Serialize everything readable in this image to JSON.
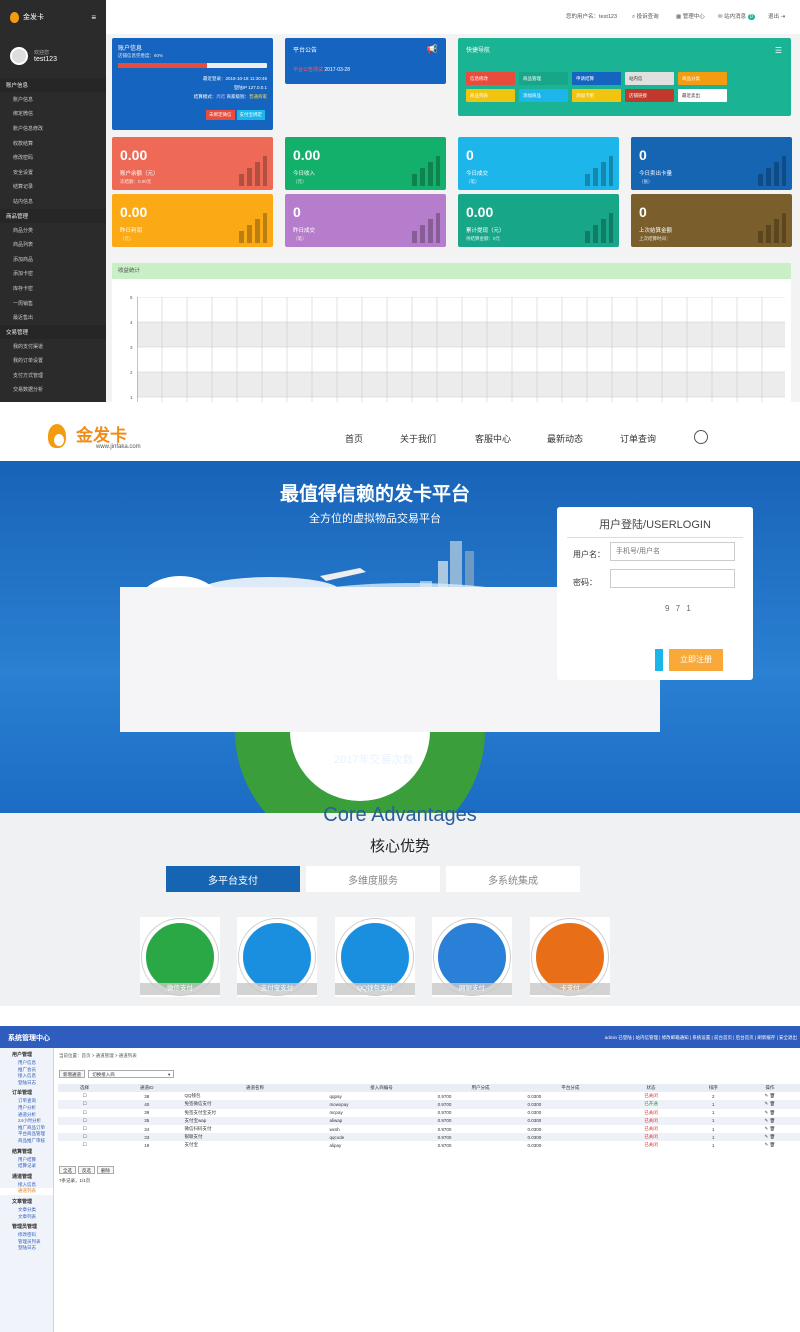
{
  "dashboard": {
    "sidebar": {
      "logo": "金发卡",
      "welcome": "欢迎您",
      "username": "test123",
      "groups": [
        {
          "title": "账户信息",
          "items": [
            "账户信息",
            "绑定微信",
            "账户信息修改",
            "收款结算",
            "修改密码",
            "安全设置",
            "结算记录",
            "站内信息"
          ]
        },
        {
          "title": "商品管理",
          "items": [
            "商品分类",
            "商品列表",
            "添加商品",
            "添加卡密",
            "库存卡密",
            "一周销售",
            "最近售出"
          ]
        },
        {
          "title": "交易管理",
          "items": [
            "我的支付渠道",
            "我的订单设置",
            "支付方式管理",
            "交易数据分析"
          ]
        }
      ]
    },
    "topbar": {
      "user": "您的用户名：test123",
      "complaint": "投诉查询",
      "manage": "管理中心",
      "messages": "站内消息",
      "message_count": "0",
      "logout": "退出"
    },
    "account_panel": {
      "title": "账户信息",
      "subtitle": "店铺信息完善度：60%",
      "progress": 0.6,
      "last_login": "最近登录：2016-10-18 11:30:46",
      "login_ip": "登陆IP 127.0.0.1",
      "settle_mode": "结算模式：",
      "settle_value": "周结",
      "level_label": "商家级别：",
      "level_value": "普通商家",
      "btn_wechat": "未绑定微信",
      "btn_pay": "支付宝绑定"
    },
    "notice_panel": {
      "title": "平台公告",
      "item": "平台公告测试",
      "date": "2017-03-28"
    },
    "quicknav": {
      "title": "快捷导航",
      "buttons": [
        "信息修改",
        "商品管理",
        "申请结算",
        "站内信",
        "商品分类",
        "商品列表",
        "添加商品",
        "添加卡密",
        "店铺链接",
        "最近卖出"
      ]
    },
    "stats": [
      {
        "value": "0.00",
        "label": "账户余额（元）",
        "sub": "冻结额：0.00元",
        "color": "#ee6a57"
      },
      {
        "value": "0.00",
        "label": "今日收入",
        "sub": "（元）",
        "color": "#13b06b"
      },
      {
        "value": "0",
        "label": "今日成交",
        "sub": "（笔）",
        "color": "#1cb6ea"
      },
      {
        "value": "0",
        "label": "今日卖出卡量",
        "sub": "（张）",
        "color": "#1565b3"
      },
      {
        "value": "0.00",
        "label": "昨日利润",
        "sub": "（元）",
        "color": "#fbaa16"
      },
      {
        "value": "0",
        "label": "昨日成交",
        "sub": "（笔）",
        "color": "#b57dcc"
      },
      {
        "value": "0.00",
        "label": "累计提现（元）",
        "sub": "待结算金额：0元",
        "color": "#18a689"
      },
      {
        "value": "0",
        "label": "上次结算金额",
        "sub": "上次结算时间：",
        "color": "#7a5e2b"
      }
    ],
    "chart": {
      "title": "收益统计",
      "y_ticks": [
        "5",
        "4",
        "3",
        "2",
        "1"
      ]
    }
  },
  "landing": {
    "brand": "金发卡",
    "domain": "www.jinfaka.com",
    "nav": [
      "首页",
      "关于我们",
      "客服中心",
      "最新动态",
      "订单查询"
    ],
    "hero_title": "最值得信赖的发卡平台",
    "hero_subtitle": "全方位的虚拟物品交易平台",
    "hero_caption": "2017年交易次数",
    "login": {
      "title": "用户登陆/USERLOGIN",
      "user_label": "用户名：",
      "user_placeholder": "手机号/用户名",
      "pass_label": "密码：",
      "captcha": "9 7 1",
      "register": "立即注册"
    },
    "advantages_en": "Core Advantages",
    "advantages_cn": "核心优势",
    "tabs": [
      "多平台支付",
      "多维度服务",
      "多系统集成"
    ],
    "features": [
      {
        "label": "微信支付",
        "color": "#2aa845"
      },
      {
        "label": "支付宝支付",
        "color": "#1a8fe0"
      },
      {
        "label": "QQ钱包支付",
        "color": "#1a8fe0"
      },
      {
        "label": "网银支付",
        "color": "#2a7fd6"
      },
      {
        "label": "卡支付",
        "color": "#e96e18"
      }
    ]
  },
  "sysadmin": {
    "title": "系统管理中心",
    "top_links": "admin 已登陆 | 站内信管理 | 修改邮箱通知 | 系统设置 | 前台首页 | 后台首页 | 刷新缓存 | 安全退出",
    "breadcrumb": "当前位置：首页 > 通道管理 > 通道列表",
    "btn_new": "新增通道",
    "select": "切换接入商",
    "sidebar": [
      {
        "title": "用户管理",
        "items": [
          "用户信息",
          "推广会员",
          "接入信息",
          "登陆日志"
        ]
      },
      {
        "title": "订单管理",
        "items": [
          "订单查询",
          "用户分析",
          "通道分析",
          "24小时分析",
          "推广商品订单",
          "平台商品管理",
          "商品推广审核"
        ]
      },
      {
        "title": "结算管理",
        "items": [
          "用户结算",
          "结算记录"
        ]
      },
      {
        "title": "通道管理",
        "items": [
          "接入信息",
          "通道列表"
        ]
      },
      {
        "title": "文章管理",
        "items": [
          "文章分类",
          "文章列表"
        ]
      },
      {
        "title": "管理员管理",
        "items": [
          "修改密码",
          "管理员列表",
          "登陆日志"
        ]
      }
    ],
    "columns": [
      "选择",
      "通道ID",
      "通道名称",
      "接入商编号",
      "用户分成",
      "平台分成",
      "状态",
      "排序",
      "操作"
    ],
    "rows": [
      [
        "38",
        "QQ钱包",
        "qqpay",
        "0.9700",
        "0.0300",
        "已关闭",
        "2"
      ],
      [
        "40",
        "免签微信支付",
        "mowxpay",
        "0.9700",
        "0.0300",
        "已开通",
        "1"
      ],
      [
        "39",
        "免签支付宝支付",
        "mcpay",
        "0.9700",
        "0.0300",
        "已关闭",
        "1"
      ],
      [
        "35",
        "支付宝wap",
        "aliwap",
        "0.9700",
        "0.0300",
        "已关闭",
        "1"
      ],
      [
        "34",
        "微信扫码支付",
        "wxsh",
        "0.9700",
        "0.0300",
        "已关闭",
        "1"
      ],
      [
        "33",
        "银联支付",
        "qqcode",
        "0.9700",
        "0.0300",
        "已关闭",
        "1"
      ],
      [
        "19",
        "支付宝",
        "alipay",
        "0.9700",
        "0.0300",
        "已关闭",
        "1"
      ]
    ],
    "footer_buttons": [
      "全选",
      "反选",
      "删除"
    ],
    "record_count": "7条记录，1/1页"
  }
}
